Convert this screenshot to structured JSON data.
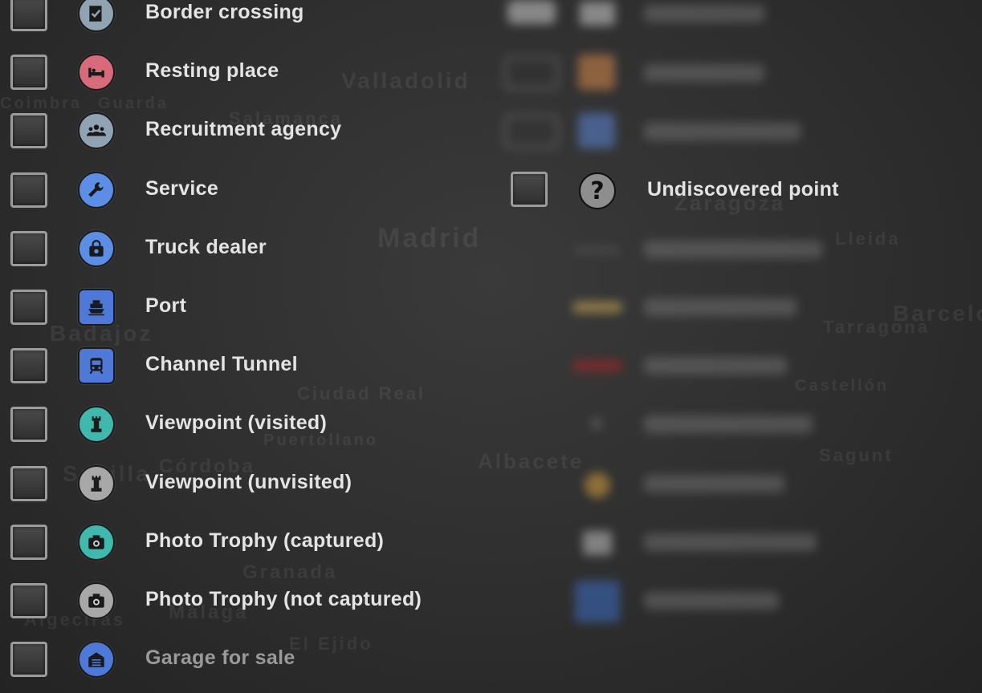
{
  "map_labels": [
    "Valladolid",
    "Salamanca",
    "Coimbra",
    "Guarda",
    "Madrid",
    "Badajoz",
    "Ciudad Real",
    "Puertollano",
    "Albacete",
    "Córdoba",
    "Sevilla",
    "Granada",
    "Málaga",
    "El Ejido",
    "Algeciras",
    "Tarragona",
    "Barcelona",
    "Lleida",
    "Zaragoza",
    "Sagunt",
    "Castellón"
  ],
  "left_column": [
    {
      "label": "Border crossing",
      "icon": "border-crossing-icon",
      "color": "#8fa3b3"
    },
    {
      "label": "Resting place",
      "icon": "bed-icon",
      "color": "#d86b7a"
    },
    {
      "label": "Recruitment agency",
      "icon": "people-icon",
      "color": "#8fa3b3"
    },
    {
      "label": "Service",
      "icon": "wrench-icon",
      "color": "#5d8ee6"
    },
    {
      "label": "Truck dealer",
      "icon": "shopping-bag-icon",
      "color": "#5d8ee6"
    },
    {
      "label": "Port",
      "icon": "ship-icon",
      "color": "#4f79d8"
    },
    {
      "label": "Channel Tunnel",
      "icon": "train-icon",
      "color": "#4f79d8"
    },
    {
      "label": "Viewpoint (visited)",
      "icon": "tower-icon",
      "color": "#3fb8ad"
    },
    {
      "label": "Viewpoint (unvisited)",
      "icon": "tower-icon",
      "color": "#a8a8a8"
    },
    {
      "label": "Photo Trophy (captured)",
      "icon": "camera-icon",
      "color": "#3fb8ad"
    },
    {
      "label": "Photo Trophy (not captured)",
      "icon": "camera-icon",
      "color": "#a8a8a8"
    },
    {
      "label": "Garage for sale",
      "icon": "garage-icon",
      "color": "#4f79d8"
    }
  ],
  "right_column": {
    "undiscovered": {
      "label": "Undiscovered point",
      "icon_text": "?"
    }
  },
  "colors": {
    "text": "#e4e4e4",
    "dim_text": "#9a9a9a",
    "checkbox_border": "#9c9c9c"
  }
}
